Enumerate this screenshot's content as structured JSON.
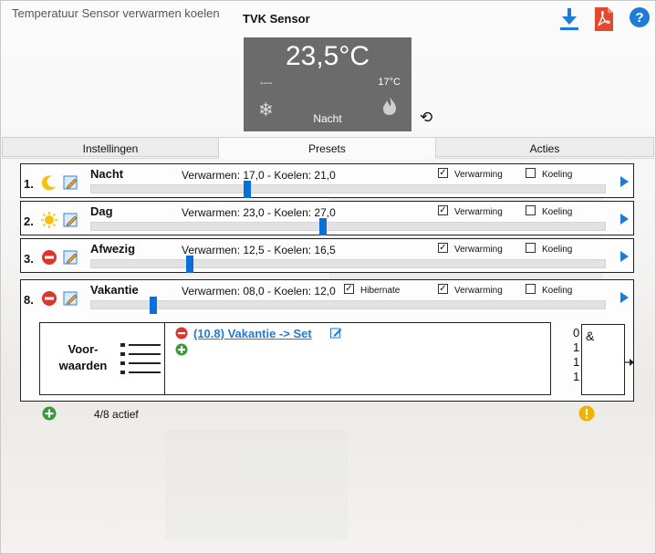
{
  "app": {
    "title": "Temperatuur Sensor verwarmen  koelen",
    "header_title": "TVK Sensor"
  },
  "toolbar": {
    "download_icon": "download-icon",
    "pdf_icon": "pdf-icon",
    "help_icon": "help-icon"
  },
  "thermostat": {
    "current_temp": "23,5°C",
    "dashes": "----",
    "set_temp": "17°C",
    "mode": "Nacht",
    "background": "#6b6b6b"
  },
  "tabs": [
    {
      "label": "Instellingen",
      "active": false
    },
    {
      "label": "Presets",
      "active": true
    },
    {
      "label": "Acties",
      "active": false
    }
  ],
  "presets": [
    {
      "num": "1.",
      "name": "Nacht",
      "values": "Verwarmen: 17,0 - Koelen: 21,0",
      "verwarming": true,
      "koeling": false,
      "level": 0.29,
      "icon": "moon-icon"
    },
    {
      "num": "2.",
      "name": "Dag",
      "values": "Verwarmen: 23,0 - Koelen: 27,0",
      "verwarming": true,
      "koeling": false,
      "level": 0.49,
      "icon": "sun-icon"
    },
    {
      "num": "3.",
      "name": "Afwezig",
      "values": "Verwarmen: 12,5 - Koelen: 16,5",
      "verwarming": true,
      "koeling": false,
      "level": 0.2,
      "icon": "remove-icon"
    },
    {
      "num": "8.",
      "name": "Vakantie",
      "values": "Verwarmen: 08,0 - Koelen: 12,0",
      "verwarming": true,
      "koeling": false,
      "hibernate": true,
      "level": 0.12,
      "icon": "remove-icon"
    }
  ],
  "labels": {
    "verwarming": "Verwarming",
    "koeling": "Koeling",
    "hibernate": "Hibernate"
  },
  "conditions": {
    "title_line1": "Voor-",
    "title_line2": "waarden",
    "link": "(10.8) Vakantie -> Set",
    "gate_symbol": "&",
    "gate_inputs": [
      "0",
      "1",
      "1",
      "1"
    ]
  },
  "footer": {
    "status": "4/8 actief"
  },
  "colors": {
    "accent": "#1f7bd6",
    "slider_thumb": "#0a6fd6",
    "remove": "#d9362c",
    "add": "#3a9a3a",
    "warning": "#f0b400"
  }
}
